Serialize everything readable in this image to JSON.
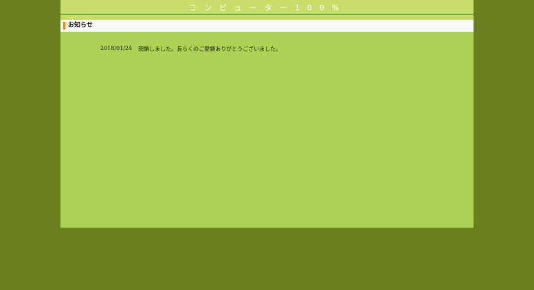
{
  "header": {
    "site_title": "コンピューター100%"
  },
  "notice_section": {
    "title": "お知らせ",
    "items": [
      {
        "date": "2018/01/24",
        "text": "閉鎖しました。長らくのご愛顧ありがとうございました。"
      }
    ]
  },
  "colors": {
    "background": "#6a801f",
    "content": "#add155",
    "header": "#c8dd6a",
    "accent": "#f08a1a"
  }
}
